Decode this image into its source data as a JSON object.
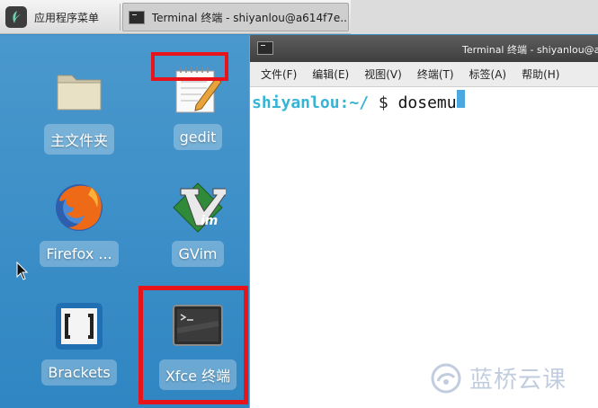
{
  "taskbar": {
    "menu_label": "应用程序菜单",
    "task_label": "Terminal 终端 - shiyanlou@a614f7e..."
  },
  "desktop": {
    "icons": [
      {
        "label": "主文件夹",
        "icon": "folder-icon"
      },
      {
        "label": "gedit",
        "icon": "gedit-icon"
      },
      {
        "label": "Firefox ...",
        "icon": "firefox-icon"
      },
      {
        "label": "GVim",
        "icon": "gvim-icon"
      },
      {
        "label": "Brackets",
        "icon": "brackets-icon"
      },
      {
        "label": "Xfce 终端",
        "icon": "terminal-icon"
      }
    ]
  },
  "terminal": {
    "title": "Terminal 终端 - shiyanlou@a6",
    "menu": [
      "文件(F)",
      "编辑(E)",
      "视图(V)",
      "终端(T)",
      "标签(A)",
      "帮助(H)"
    ],
    "prompt_user": "shiyanlou",
    "prompt_path": ":~/",
    "prompt_symbol": " $ ",
    "command": "dosemu"
  },
  "watermark": {
    "text": "蓝桥云课"
  },
  "colors": {
    "highlight": "#e8141c",
    "desktop": "#3a8cc4",
    "prompt": "#35b4d6"
  }
}
